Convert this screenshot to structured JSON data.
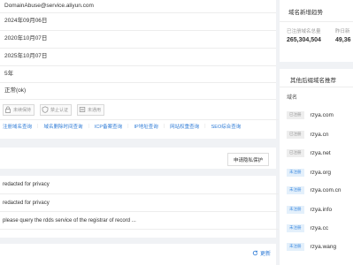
{
  "whois": {
    "rows": [
      {
        "value": "DomainAbuse@service.aliyun.com"
      },
      {
        "value": "2024年09月06日"
      },
      {
        "value": "2020年10月07日"
      },
      {
        "value": "2025年10月07日"
      },
      {
        "value": "5年"
      },
      {
        "value": "正常(ok)"
      }
    ],
    "badges": [
      {
        "label": "未续保持"
      },
      {
        "label": "禁止认证"
      },
      {
        "label": "未通用"
      }
    ],
    "links": [
      "注册域名查询",
      "域名删除时间查询",
      "ICP备案查询",
      "IP地址查询",
      "网站权重查询",
      "SEO综合查询"
    ]
  },
  "privacy": {
    "button_label": "申请隐私保护"
  },
  "raw_rows": [
    "redacted for privacy",
    "redacted for privacy",
    "please query the rdds service of the registrar of record ..."
  ],
  "footer": {
    "refresh_label": "更新"
  },
  "stats": {
    "title": "域名新增趋势",
    "registered_label": "已注册域名总量",
    "registered_value": "265,304,504",
    "yesterday_label": "昨日新",
    "yesterday_value": "49,36"
  },
  "suffix": {
    "title": "其他后缀域名推荐",
    "column_label": "域名",
    "items": [
      {
        "tag": "已注册",
        "domain": "rzya.com",
        "status": "registered"
      },
      {
        "tag": "已注册",
        "domain": "rzya.cn",
        "status": "registered"
      },
      {
        "tag": "已注册",
        "domain": "rzya.net",
        "status": "registered"
      },
      {
        "tag": "未注册",
        "domain": "rzya.org",
        "status": "unregistered"
      },
      {
        "tag": "未注册",
        "domain": "rzya.com.cn",
        "status": "unregistered"
      },
      {
        "tag": "未注册",
        "domain": "rzya.info",
        "status": "unregistered"
      },
      {
        "tag": "未注册",
        "domain": "rzya.cc",
        "status": "unregistered"
      },
      {
        "tag": "未注册",
        "domain": "rzya.wang",
        "status": "unregistered"
      }
    ]
  }
}
